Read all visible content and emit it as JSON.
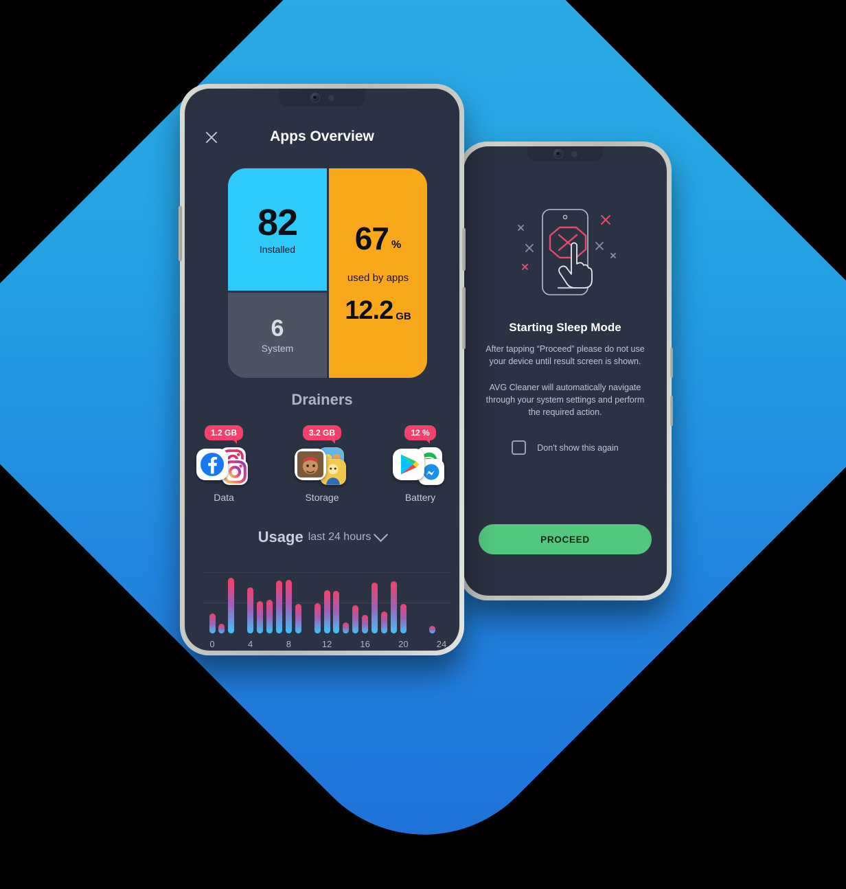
{
  "background": {
    "diamond_color_light": "#2FAEE8",
    "diamond_color_dark": "#1E6FD9"
  },
  "front_phone": {
    "appbar": {
      "close_icon": "close-icon",
      "title": "Apps Overview"
    },
    "cards": {
      "installed": {
        "value": "82",
        "label": "Installed",
        "color": "#2ECAFB"
      },
      "system": {
        "value": "6",
        "label": "System",
        "color": "#4C5463"
      },
      "usage": {
        "percent": "67",
        "percent_unit": "%",
        "caption": "used by apps",
        "size": "12.2",
        "size_unit": "GB",
        "color": "#F9A81B"
      }
    },
    "drainers": {
      "title": "Drainers",
      "items": [
        {
          "badge": "1.2 GB",
          "label": "Data",
          "front_icon": "facebook-icon",
          "back_icons": [
            "instagram-icon",
            "instagram-icon"
          ]
        },
        {
          "badge": "3.2 GB",
          "label": "Storage",
          "front_icon": "game-app-icon",
          "back_icons": [
            "game-app-icon",
            "game-app-icon"
          ]
        },
        {
          "badge": "12 %",
          "label": "Battery",
          "front_icon": "google-play-icon",
          "back_icons": [
            "spotify-icon",
            "messenger-icon"
          ]
        }
      ],
      "badge_color": "#F2426B"
    },
    "usage_section": {
      "title": "Usage",
      "subtitle": "last 24 hours",
      "dropdown_icon": "chevron-down-icon"
    },
    "chart_data": {
      "type": "bar",
      "title": "Usage",
      "subtitle": "last 24 hours",
      "xlabel": "",
      "ylabel": "",
      "grid": true,
      "gridlines": [
        0.5,
        1.0
      ],
      "legend": null,
      "xlim": [
        0,
        24
      ],
      "ylim": [
        0,
        1
      ],
      "tick_labels": [
        "0",
        "4",
        "8",
        "12",
        "16",
        "20",
        "24"
      ],
      "tick_values": [
        0,
        4,
        8,
        12,
        16,
        20,
        24
      ],
      "bar_gradient": {
        "top": "#F2416A",
        "mid": "#A060B4",
        "bottom": "#3FC3F7"
      },
      "x": [
        0,
        1,
        2,
        3,
        4,
        5,
        6,
        7,
        8,
        9,
        11,
        12,
        13,
        14,
        15,
        16,
        17,
        18,
        19,
        20,
        21,
        23
      ],
      "values": [
        0.33,
        0.16,
        0.92,
        0.0,
        0.76,
        0.53,
        0.56,
        0.88,
        0.89,
        0.49,
        0.5,
        0.72,
        0.7,
        0.18,
        0.47,
        0.31,
        0.84,
        0.36,
        0.86,
        0.49,
        0.0,
        0.13
      ]
    }
  },
  "back_phone": {
    "illustration": "phone-blocked-tap-icon",
    "title": "Starting Sleep Mode",
    "paragraph1": "After tapping “Proceed” please do not use your device until result screen is shown.",
    "paragraph2": "AVG Cleaner will automatically navigate through your system settings and perform the required action.",
    "checkbox_label": "Don't show this again",
    "button_label": "PROCEED",
    "button_color": "#52C77E"
  }
}
